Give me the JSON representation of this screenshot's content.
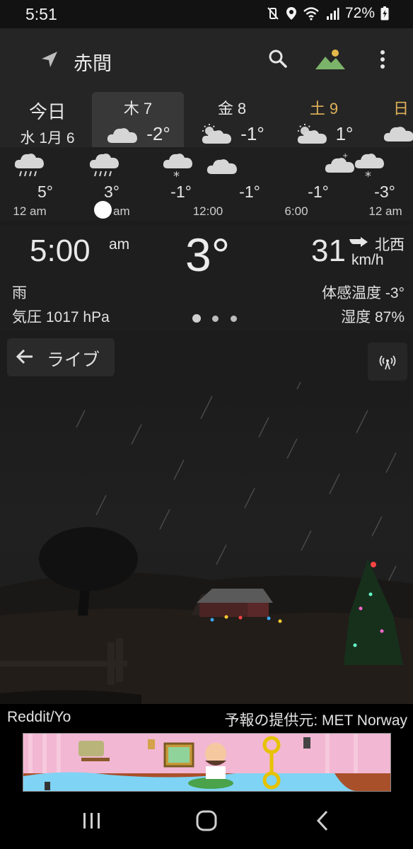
{
  "status_bar": {
    "time": "5:51",
    "battery_percent": "72%",
    "icons": [
      "mute-vibrate-icon",
      "location-pin-icon",
      "wifi-icon",
      "cell-signal-icon",
      "battery-icon"
    ]
  },
  "app_bar": {
    "city": "赤間",
    "icons": [
      "location-arrow-icon",
      "search-icon",
      "landscape-icon",
      "more-vert-icon"
    ]
  },
  "days": [
    {
      "name": "今日",
      "date": "水 1月 6",
      "selected": false,
      "weekend": false
    },
    {
      "name": "木 7",
      "temp": "-2°",
      "icon": "cloud-icon",
      "selected": true,
      "weekend": false
    },
    {
      "name": "金 8",
      "temp": "-1°",
      "icon": "partly-cloudy-icon",
      "selected": false,
      "weekend": false
    },
    {
      "name": "土 9",
      "temp": "1°",
      "icon": "partly-cloudy-icon",
      "selected": false,
      "weekend": true
    },
    {
      "name": "日",
      "icon": "cloud-icon",
      "selected": false,
      "weekend": true
    }
  ],
  "hourly": {
    "temps": [
      "5°",
      "3°",
      "-1°",
      "-1°",
      "-1°",
      "-3°"
    ],
    "times": [
      "12 am",
      "am",
      "12:00",
      "6:00",
      "12 am"
    ],
    "icons": [
      "rain-cloud-icon",
      "rain-cloud-icon",
      "snow-cloud-icon",
      "cloud-icon",
      "night-cloud-icon",
      "snow-cloud-icon"
    ]
  },
  "current": {
    "time": "5:00",
    "ampm": "am",
    "temperature": "3°",
    "wind_speed": "31",
    "wind_direction": "北西",
    "wind_unit": "km/h",
    "condition": "雨",
    "pressure": "気圧 1017 hPa",
    "feels_like": "体感温度 -3°",
    "humidity": "湿度 87%"
  },
  "live": {
    "label": "ライブ"
  },
  "credits": {
    "left": "Reddit/Yo",
    "right": "予報の提供元: MET Norway"
  },
  "nav": [
    "recent-apps-icon",
    "home-icon",
    "back-icon"
  ],
  "colors": {
    "background": "#1c1c1c",
    "appbar": "#252525",
    "selected_tab": "#383838",
    "weekend_text": "#e0b25a",
    "ad_background": "#f2b7d2"
  }
}
